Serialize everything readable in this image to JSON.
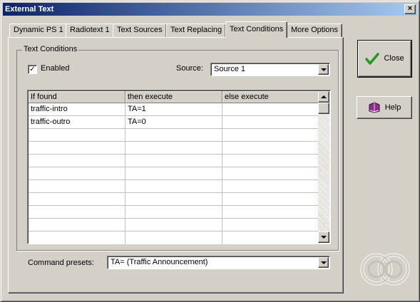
{
  "window": {
    "title": "External Text"
  },
  "tabs": [
    {
      "label": "Dynamic PS 1"
    },
    {
      "label": "Radiotext 1"
    },
    {
      "label": "Text Sources"
    },
    {
      "label": "Text Replacing"
    },
    {
      "label": "Text Conditions",
      "active": true
    },
    {
      "label": "More Options"
    }
  ],
  "group": {
    "title": "Text Conditions",
    "enabled_label": "Enabled",
    "enabled_checked": true,
    "checkmark": "✓",
    "source_label": "Source:",
    "source_value": "Source 1"
  },
  "grid": {
    "columns": [
      "If found",
      "then execute",
      "else execute"
    ],
    "rows": [
      [
        "traffic-intro",
        "TA=1",
        ""
      ],
      [
        "traffic-outro",
        "TA=0",
        ""
      ],
      [
        "",
        "",
        ""
      ],
      [
        "",
        "",
        ""
      ],
      [
        "",
        "",
        ""
      ],
      [
        "",
        "",
        ""
      ],
      [
        "",
        "",
        ""
      ],
      [
        "",
        "",
        ""
      ],
      [
        "",
        "",
        ""
      ],
      [
        "",
        "",
        ""
      ],
      [
        "",
        "",
        ""
      ]
    ]
  },
  "presets": {
    "label": "Command presets:",
    "value": "TA= (Traffic Announcement)"
  },
  "buttons": {
    "close_label": "Close",
    "help_label": "Help"
  },
  "colors": {
    "title_start": "#0a246a",
    "title_end": "#a6caf0",
    "face": "#d4d0c8",
    "check_green": "#1e9a1e",
    "book_purple": "#8a2f8a"
  }
}
